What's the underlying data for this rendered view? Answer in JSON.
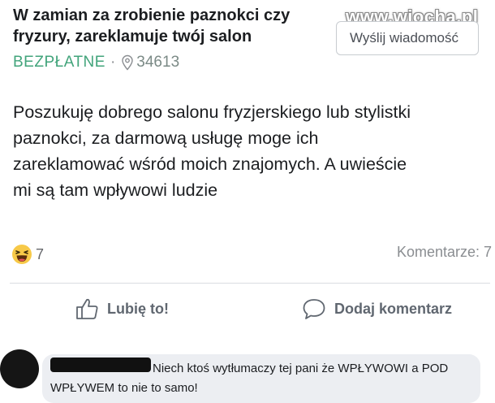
{
  "listing": {
    "title": "W zamian za zrobienie paznokci czy fryzury, zareklamuje twój salon",
    "price": "BEZPŁATNE",
    "separator": "·",
    "location": "34613",
    "send_button": "Wyślij wiadomość",
    "watermark": "www.wiocha.pl",
    "body": "Poszukuję dobrego salonu fryzjerskiego lub stylistki\npaznokci,  za darmową usługę moge ich\nzareklamować wśród moich znajomych. A uwieście\nmi są tam wpływowi ludzie"
  },
  "stats": {
    "reaction_icon": "haha-emoji-icon",
    "reaction_count": "7",
    "comments": "Komentarze: 7"
  },
  "actions": {
    "like_label": "Lubię to!",
    "comment_label": "Dodaj komentarz"
  },
  "comment": {
    "text": "Niech ktoś wytłumaczy tej pani że WPŁYWOWI a POD WPŁYWEM to nie to samo!"
  },
  "colors": {
    "price_green": "#42a47b",
    "meta_gray": "#8a8d91",
    "bubble_bg": "#eceef2"
  }
}
